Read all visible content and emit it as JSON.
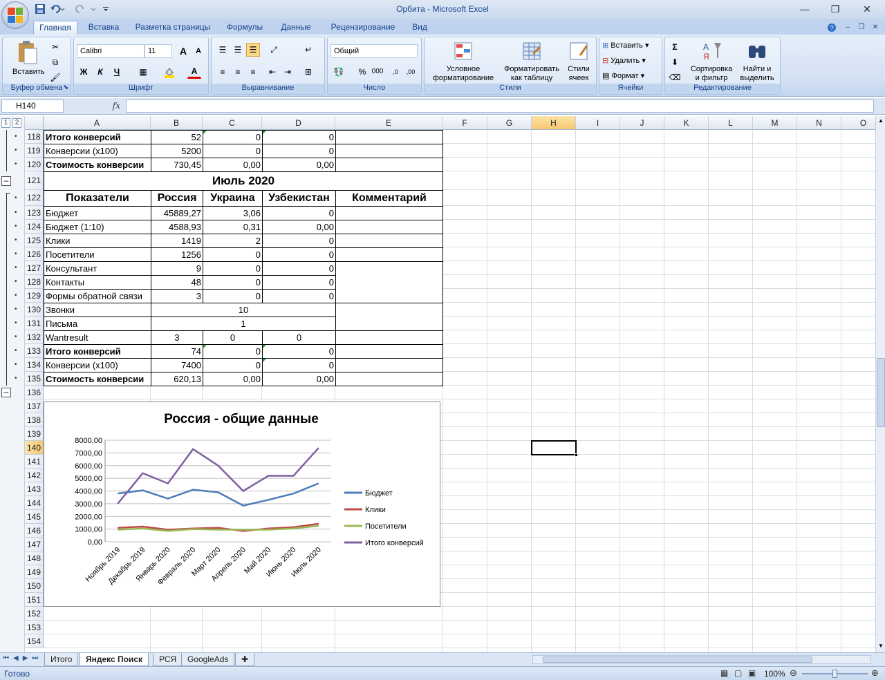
{
  "window": {
    "title": "Орбита - Microsoft Excel"
  },
  "tabs": [
    "Главная",
    "Вставка",
    "Разметка страницы",
    "Формулы",
    "Данные",
    "Рецензирование",
    "Вид"
  ],
  "ribbon": {
    "clipboard": {
      "label": "Буфер обмена",
      "paste": "Вставить"
    },
    "font": {
      "label": "Шрифт",
      "name": "Calibri",
      "size": "11",
      "bold": "Ж",
      "italic": "К",
      "underline": "Ч",
      "grow": "A",
      "shrink": "A",
      "color": "A"
    },
    "alignment": {
      "label": "Выравнивание"
    },
    "number": {
      "label": "Число",
      "format": "Общий",
      "percent": "%",
      "thousands": "000",
      "inc": ",0",
      "dec": ",00"
    },
    "styles": {
      "label": "Стили",
      "conditional_1": "Условное",
      "conditional_2": "форматирование",
      "table_1": "Форматировать",
      "table_2": "как таблицу",
      "cell_1": "Стили",
      "cell_2": "ячеек"
    },
    "cells": {
      "label": "Ячейки",
      "insert": "Вставить",
      "delete": "Удалить",
      "format": "Формат"
    },
    "editing": {
      "label": "Редактирование",
      "sigma": "Σ",
      "sort_1": "Сортировка",
      "sort_2": "и фильтр",
      "find_1": "Найти и",
      "find_2": "выделить"
    }
  },
  "formula_bar": {
    "name_box": "H140",
    "fx": "fx",
    "value": ""
  },
  "columns": [
    "A",
    "B",
    "C",
    "D",
    "E",
    "F",
    "G",
    "H",
    "I",
    "J",
    "K",
    "L",
    "M",
    "N",
    "O"
  ],
  "outline_levels": [
    "1",
    "2"
  ],
  "rows": [
    "118",
    "119",
    "120",
    "121",
    "122",
    "123",
    "124",
    "125",
    "126",
    "127",
    "128",
    "129",
    "130",
    "131",
    "132",
    "133",
    "134",
    "135",
    "136",
    "137",
    "138",
    "139",
    "140",
    "141",
    "142",
    "143",
    "144",
    "145",
    "146",
    "147",
    "148",
    "149",
    "150",
    "151",
    "152",
    "153",
    "154"
  ],
  "table": {
    "top_rows": [
      {
        "a": "Итого конверсий",
        "b": "52",
        "c": "0",
        "d": "0",
        "bold": true
      },
      {
        "a": "Конверсии (x100)",
        "b": "5200",
        "c": "0",
        "d": "0",
        "bold": false
      },
      {
        "a": "Стоимость конверсии",
        "b": "730,45",
        "c": "0,00",
        "d": "0,00",
        "bold": true
      }
    ],
    "section_title": "Июль 2020",
    "headers": [
      "Показатели",
      "Россия",
      "Украина",
      "Узбекистан",
      "Комментарий"
    ],
    "rows": [
      {
        "a": "Бюджет",
        "b": "45889,27",
        "c": "3,06",
        "d": "0"
      },
      {
        "a": "Бюджет (1:10)",
        "b": "4588,93",
        "c": "0,31",
        "d": "0,00"
      },
      {
        "a": "Клики",
        "b": "1419",
        "c": "2",
        "d": "0"
      },
      {
        "a": "Посетители",
        "b": "1256",
        "c": "0",
        "d": "0"
      },
      {
        "a": "Консультант",
        "b": "9",
        "c": "0",
        "d": "0"
      },
      {
        "a": "Контакты",
        "b": "48",
        "c": "0",
        "d": "0"
      },
      {
        "a": "Формы обратной связи",
        "b": "3",
        "c": "0",
        "d": "0"
      }
    ],
    "calls": {
      "label": "Звонки",
      "value": "10"
    },
    "letters": {
      "label": "Письма",
      "value": "1"
    },
    "wantresult": {
      "a": "Wantresult",
      "b": "3",
      "c": "0",
      "d": "0"
    },
    "bottom_rows": [
      {
        "a": "Итого конверсий",
        "b": "74",
        "c": "0",
        "d": "0",
        "bold": true
      },
      {
        "a": "Конверсии (x100)",
        "b": "7400",
        "c": "0",
        "d": "0",
        "bold": false
      },
      {
        "a": "Стоимость конверсии",
        "b": "620,13",
        "c": "0,00",
        "d": "0,00",
        "bold": true
      }
    ]
  },
  "chart_data": {
    "type": "line",
    "title": "Россия - общие данные",
    "categories": [
      "Ноябрь 2019",
      "Декабрь 2019",
      "Январь 2020",
      "Февраль 2020",
      "Март 2020",
      "Апрель 2020",
      "Май 2020",
      "Июнь 2020",
      "Июль 2020"
    ],
    "yticks": [
      "0,00",
      "1000,00",
      "2000,00",
      "3000,00",
      "4000,00",
      "5000,00",
      "6000,00",
      "7000,00",
      "8000,00"
    ],
    "ylim": [
      0,
      8000
    ],
    "legend_position": "right",
    "series": [
      {
        "name": "Бюджет",
        "color": "#4a7ebb",
        "values": [
          3800,
          4050,
          3400,
          4100,
          3900,
          2850,
          3300,
          3800,
          4600
        ]
      },
      {
        "name": "Клики",
        "color": "#be4b48",
        "values": [
          1100,
          1200,
          950,
          1050,
          1100,
          850,
          1050,
          1150,
          1420
        ]
      },
      {
        "name": "Посетители",
        "color": "#98b954",
        "values": [
          950,
          1050,
          850,
          1000,
          950,
          950,
          950,
          1050,
          1260
        ]
      },
      {
        "name": "Итого конверсий",
        "color": "#7d60a0",
        "values": [
          3000,
          5400,
          4600,
          7300,
          6000,
          4000,
          5200,
          5200,
          7400
        ]
      }
    ]
  },
  "sheets": [
    "Итого",
    "Яндекс Поиск",
    "РСЯ",
    "GoogleAds"
  ],
  "status": {
    "ready": "Готово",
    "zoom": "100%"
  }
}
